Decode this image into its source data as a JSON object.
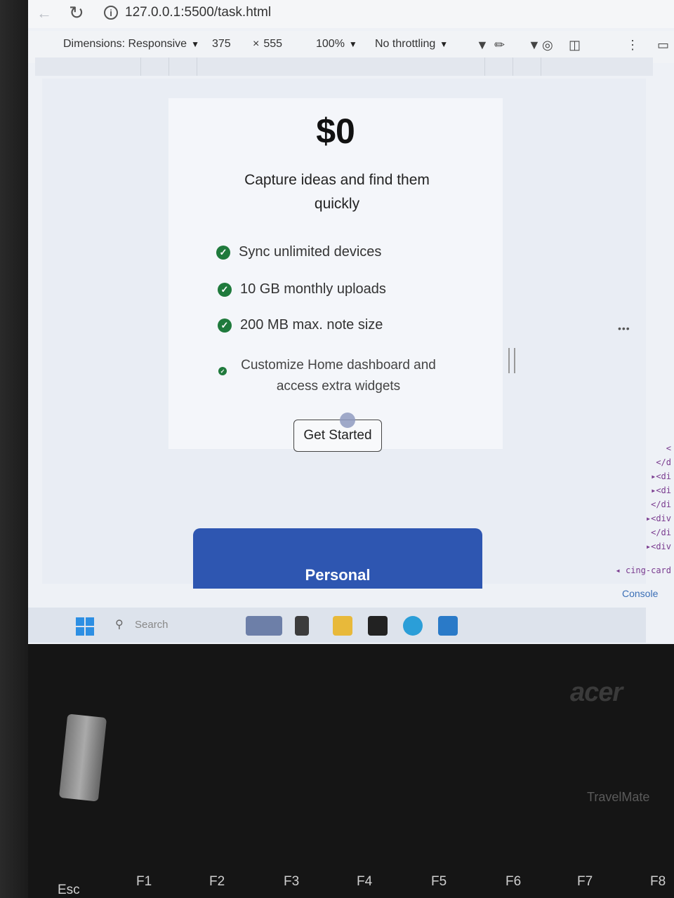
{
  "browser": {
    "url": "127.0.0.1:5500/task.html"
  },
  "device_toolbar": {
    "dimensions_label": "Dimensions: Responsive",
    "width": "375",
    "height_prefix": "×",
    "height": "555",
    "zoom": "100%",
    "throttling": "No throttling"
  },
  "card": {
    "price": "$0",
    "description": "Capture ideas and find them quickly",
    "features": [
      "Sync unlimited devices",
      "10 GB monthly uploads",
      "200 MB max. note size",
      "Customize Home dashboard and access extra widgets"
    ],
    "button_label": "Get Started"
  },
  "next_card": {
    "title": "Personal"
  },
  "devtools": {
    "code_lines": [
      "<",
      "</d",
      "▸<di",
      "▸<di",
      "</di",
      "▸<div",
      "</di",
      "▸<div",
      "◂ cing-card"
    ],
    "console_tab": "Console"
  },
  "taskbar": {
    "search_label": "Search"
  },
  "laptop": {
    "brand": "acer",
    "model": "TravelMate",
    "keys": [
      "Esc",
      "F1",
      "F2",
      "F3",
      "F4",
      "F5",
      "F6",
      "F7",
      "F8"
    ]
  }
}
